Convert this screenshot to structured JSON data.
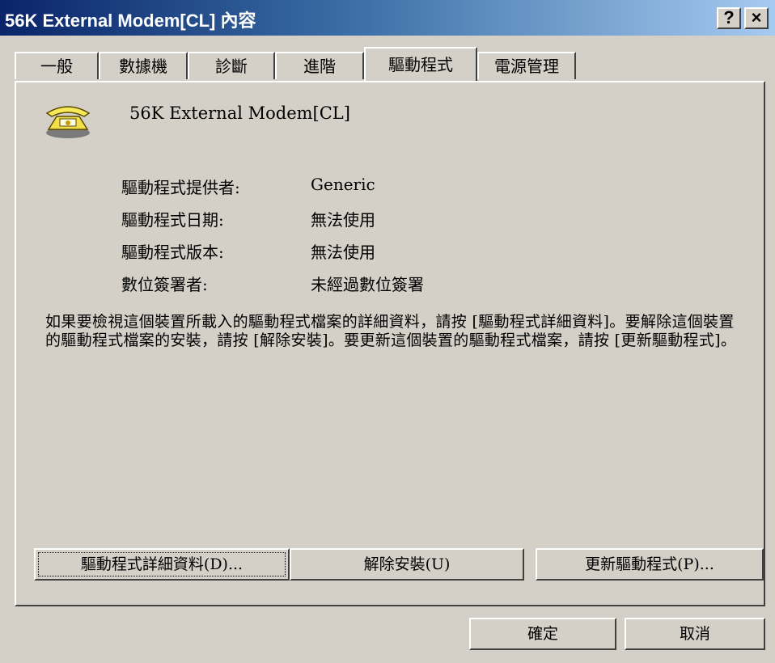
{
  "window": {
    "title": "56K External Modem[CL] 內容",
    "help_button": "?",
    "close_button": "×"
  },
  "tabs": [
    {
      "label": "一般"
    },
    {
      "label": "數據機"
    },
    {
      "label": "診斷"
    },
    {
      "label": "進階"
    },
    {
      "label": "驅動程式",
      "active": true
    },
    {
      "label": "電源管理"
    }
  ],
  "driver_tab": {
    "device_icon": "modem-telephone-icon",
    "device_name": "56K External Modem[CL]",
    "fields": [
      {
        "label": "驅動程式提供者:",
        "value": "Generic"
      },
      {
        "label": "驅動程式日期:",
        "value": "無法使用"
      },
      {
        "label": "驅動程式版本:",
        "value": "無法使用"
      },
      {
        "label": "數位簽署者:",
        "value": "未經過數位簽署"
      }
    ],
    "description": "如果要檢視這個裝置所載入的驅動程式檔案的詳細資料，請按 [驅動程式詳細資料]。要解除這個裝置的驅動程式檔案的安裝，請按 [解除安裝]。要更新這個裝置的驅動程式檔案，請按 [更新驅動程式]。",
    "buttons": {
      "details": "驅動程式詳細資料(D)...",
      "uninstall": "解除安裝(U)",
      "update": "更新驅動程式(P)..."
    }
  },
  "footer": {
    "ok": "確定",
    "cancel": "取消"
  }
}
